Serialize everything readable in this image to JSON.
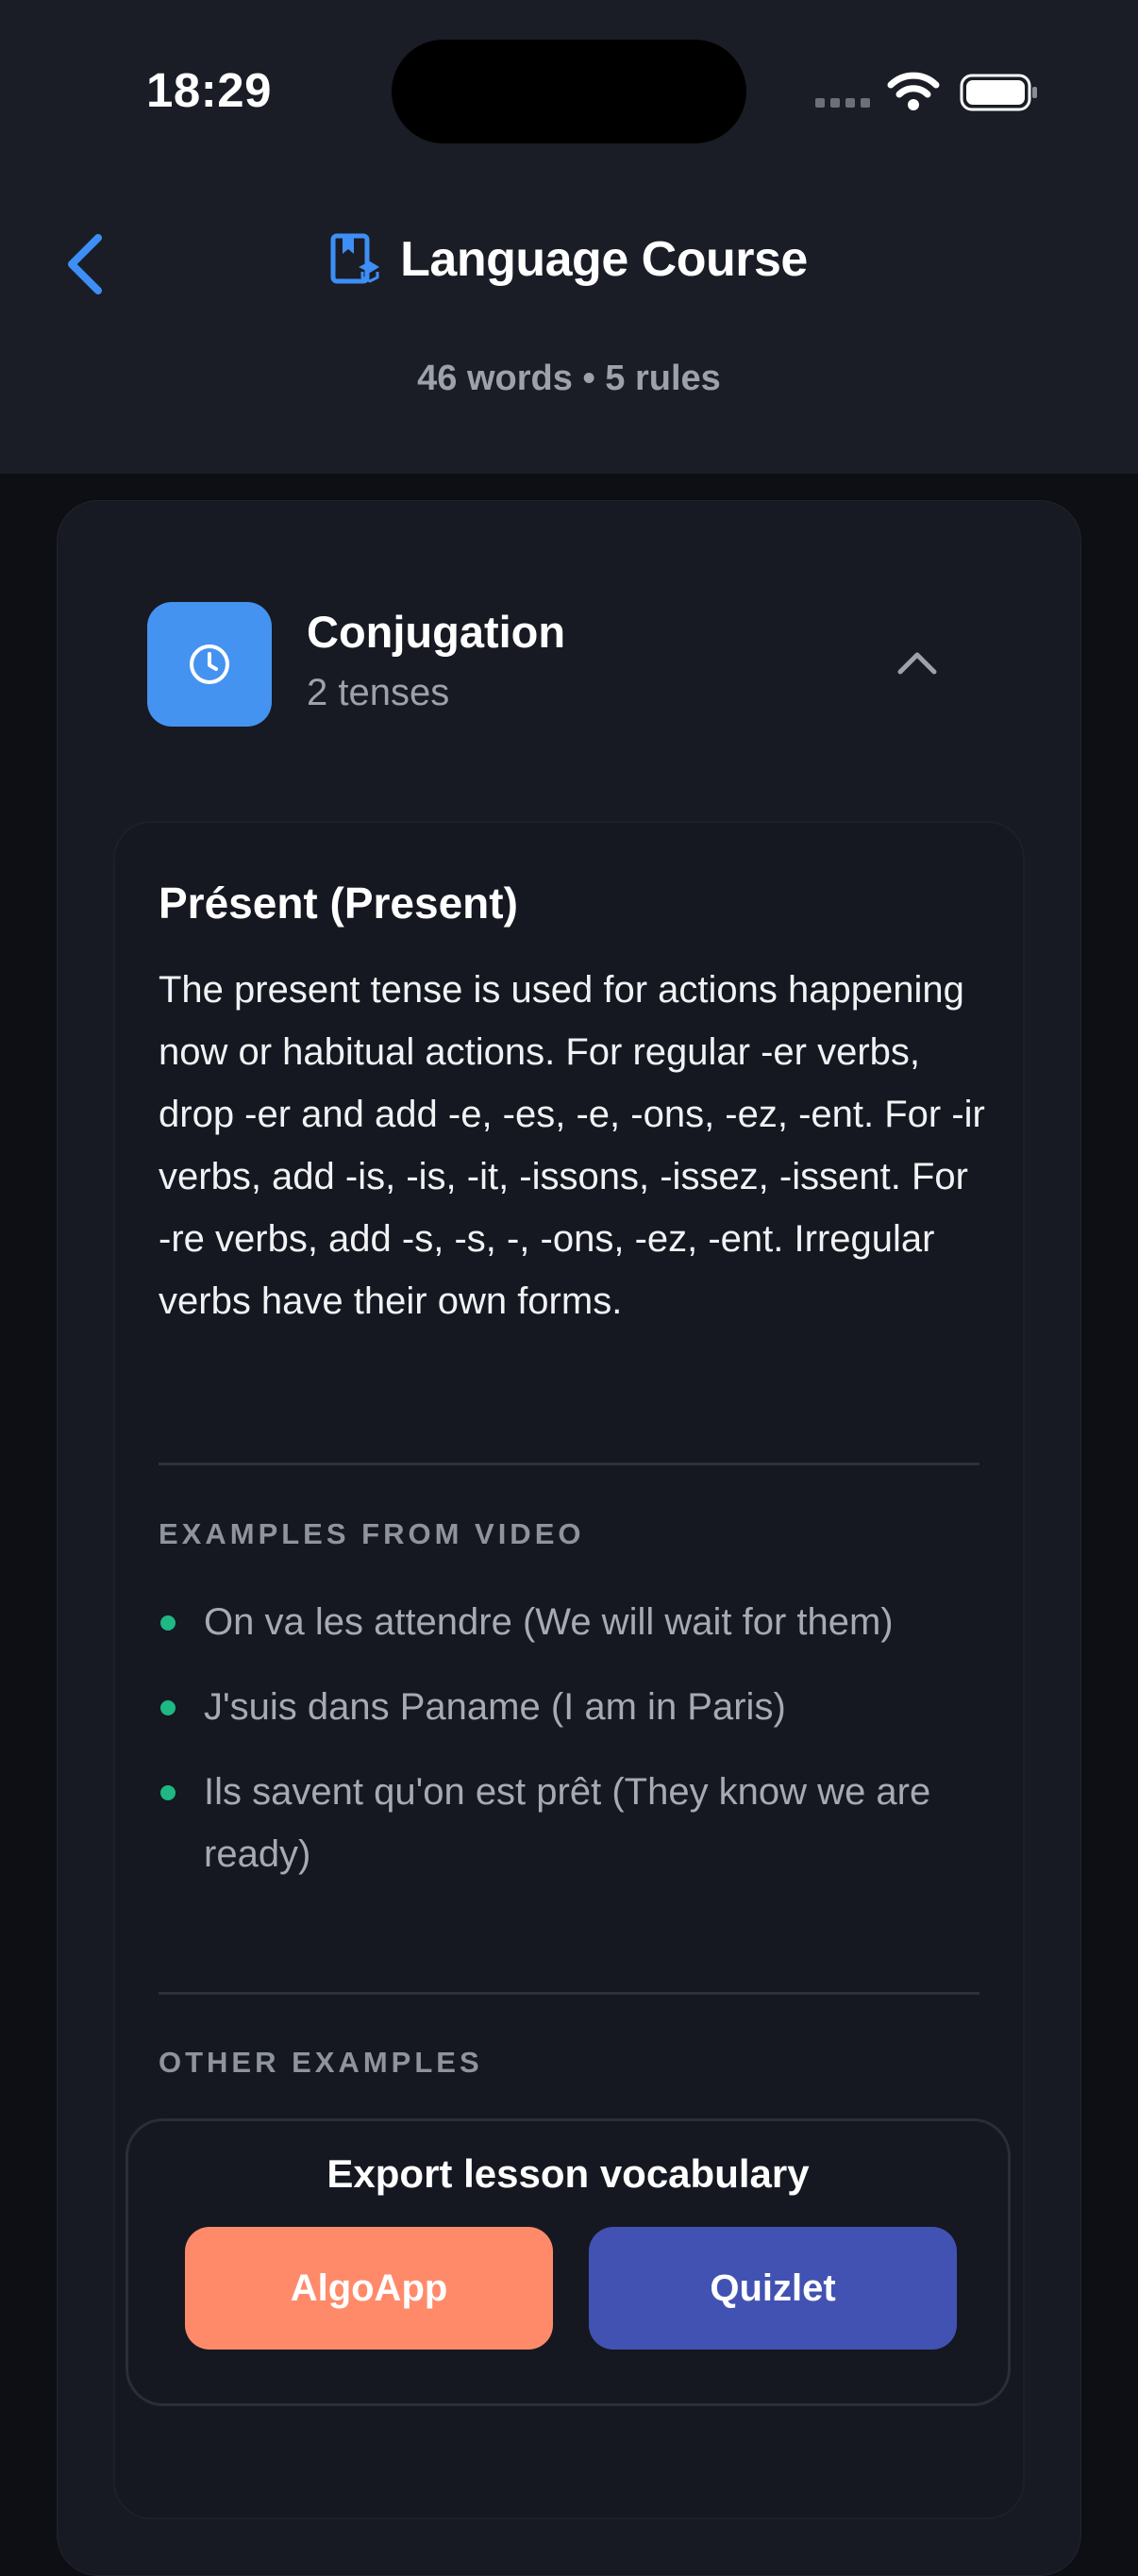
{
  "status_bar": {
    "time": "18:29"
  },
  "header": {
    "title": "Language Course",
    "subtitle": "46 words • 5 rules"
  },
  "section": {
    "title": "Conjugation",
    "subtitle": "2 tenses"
  },
  "rule": {
    "title": "Présent (Present)",
    "description": "The present tense is used for actions happening now or habitual actions. For regular -er verbs, drop -er and add -e, -es, -e, -ons, -ez, -ent. For -ir verbs, add -is, -is, -it, -issons, -issez, -issent. For -re verbs, add -s, -s, -, -ons, -ez, -ent. Irregular verbs have their own forms.",
    "examples_label": "EXAMPLES FROM VIDEO",
    "examples": [
      "On va les attendre (We will wait for them)",
      "J'suis dans Paname (I am in Paris)",
      "Ils savent qu'on est prêt (They know we are ready)"
    ],
    "other_label": "OTHER EXAMPLES"
  },
  "export": {
    "title": "Export lesson vocabulary",
    "algoapp_label": "AlgoApp",
    "quizlet_label": "Quizlet"
  },
  "colors": {
    "accent_blue": "#4593f0",
    "bullet_green": "#1fb784",
    "algoapp": "#ff8a6a",
    "quizlet": "#4252b3"
  }
}
